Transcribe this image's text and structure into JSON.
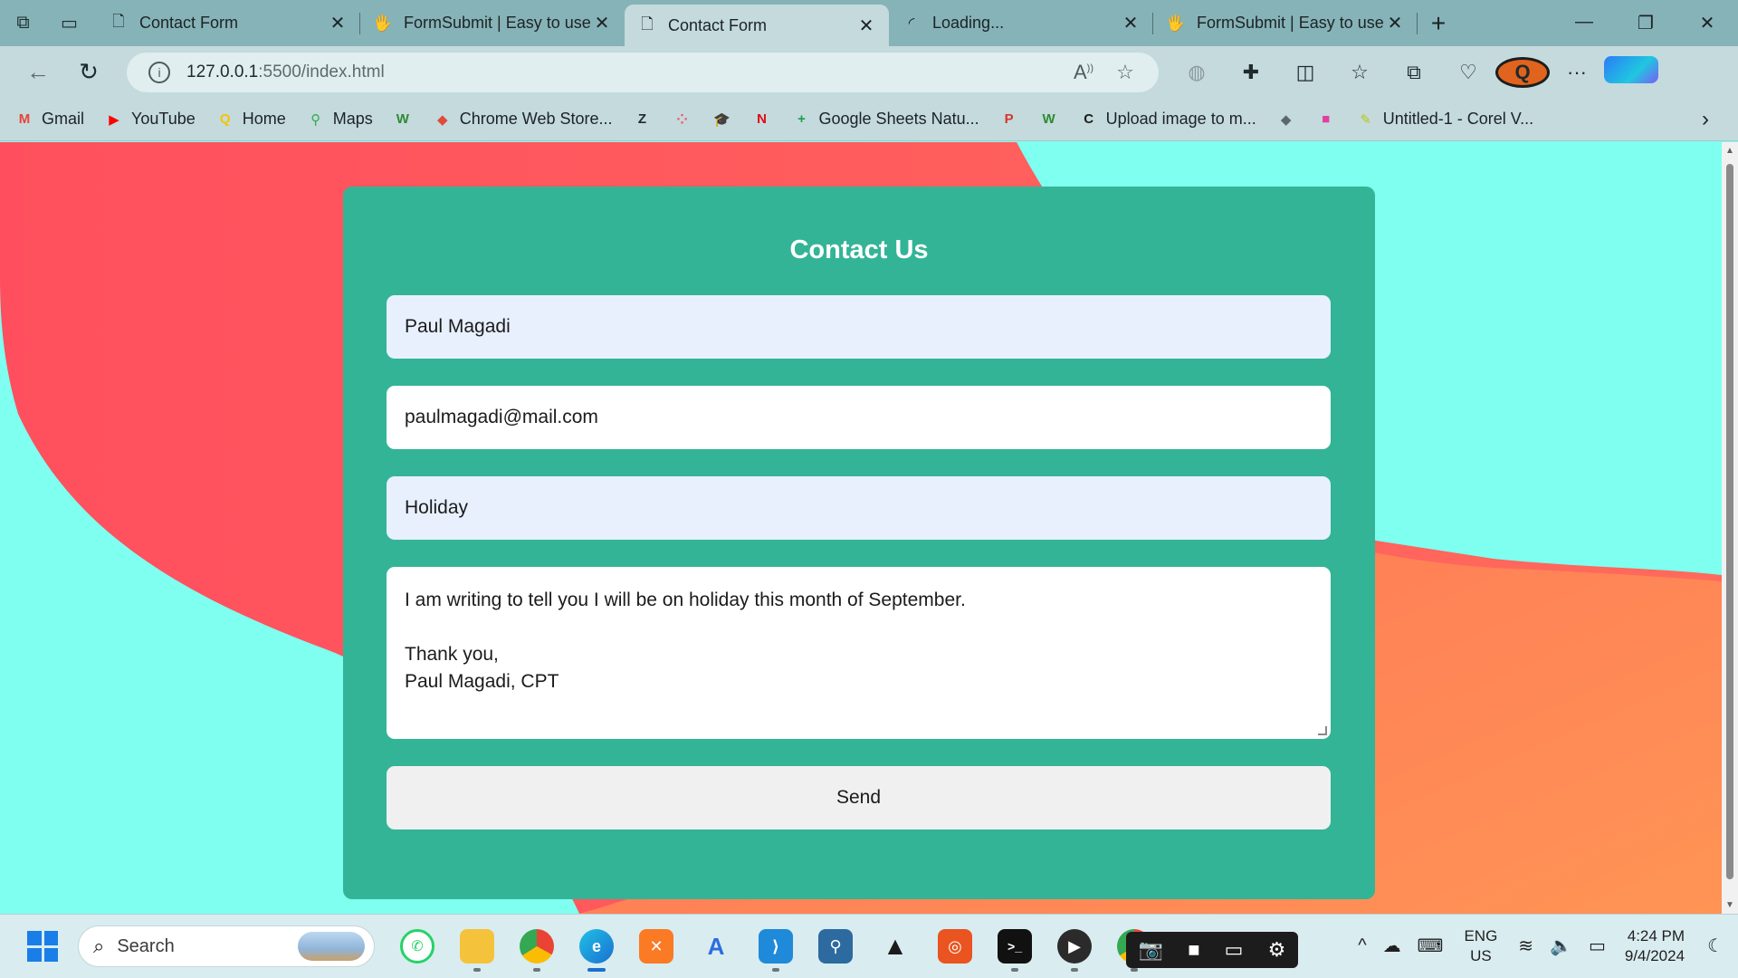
{
  "browser": {
    "tabs": [
      {
        "title": "Contact Form",
        "icon": "page-icon"
      },
      {
        "title": "FormSubmit | Easy to use",
        "icon": "formsubmit-icon"
      },
      {
        "title": "Contact Form",
        "icon": "page-icon",
        "active": true
      },
      {
        "title": "Loading...",
        "icon": "loading-spinner-icon"
      },
      {
        "title": "FormSubmit | Easy to use",
        "icon": "formsubmit-icon"
      }
    ],
    "url_host": "127.0.0.1",
    "url_rest": ":5500/index.html",
    "bookmarks": [
      {
        "label": "Gmail",
        "icon": "gmail-icon",
        "color": "#ea4335"
      },
      {
        "label": "YouTube",
        "icon": "youtube-icon",
        "color": "#ff0000"
      },
      {
        "label": "Home",
        "icon": "home-q-icon",
        "color": "#f5c400"
      },
      {
        "label": "Maps",
        "icon": "maps-icon",
        "color": "#34a853"
      },
      {
        "label": "",
        "icon": "w-icon",
        "color": "#2e8b32"
      },
      {
        "label": "Chrome Web Store...",
        "icon": "web-store-icon",
        "color": "#e04a3a"
      },
      {
        "label": "",
        "icon": "z-icon",
        "color": "#1d2b2d"
      },
      {
        "label": "",
        "icon": "dots-icon",
        "color": "#f0506e"
      },
      {
        "label": "",
        "icon": "grad-cap-icon",
        "color": "#2aa6e0"
      },
      {
        "label": "",
        "icon": "netflix-icon",
        "color": "#e50914"
      },
      {
        "label": "Google Sheets Natu...",
        "icon": "sheets-icon",
        "color": "#1e9e4a"
      },
      {
        "label": "",
        "icon": "pdf-doc-icon",
        "color": "#d9342b"
      },
      {
        "label": "",
        "icon": "w-icon",
        "color": "#2e8b32"
      },
      {
        "label": "Upload image to m...",
        "icon": "c-icon",
        "color": "#1c1c1c"
      },
      {
        "label": "",
        "icon": "layers-icon",
        "color": "#5a6770"
      },
      {
        "label": "",
        "icon": "color-squares-icon",
        "color": "#e040a0"
      },
      {
        "label": "Untitled-1 - Corel V...",
        "icon": "corel-icon",
        "color": "#b8c61a"
      }
    ]
  },
  "page": {
    "form_title": "Contact Us",
    "name_value": "Paul Magadi",
    "email_value": "paulmagadi@mail.com",
    "subject_value": "Holiday",
    "message_value": "I am writing to tell you I will be on holiday this month of September.\n\nThank you,\nPaul Magadi, CPT",
    "send_label": "Send",
    "colors": {
      "card": "#33b497",
      "bg_cyan": "#7ffff0",
      "blob_red": "#ff5563",
      "blob_orange": "#ff8a52"
    }
  },
  "taskbar": {
    "search_placeholder": "Search",
    "lang_line1": "ENG",
    "lang_line2": "US",
    "time": "4:24 PM",
    "date": "9/4/2024"
  }
}
